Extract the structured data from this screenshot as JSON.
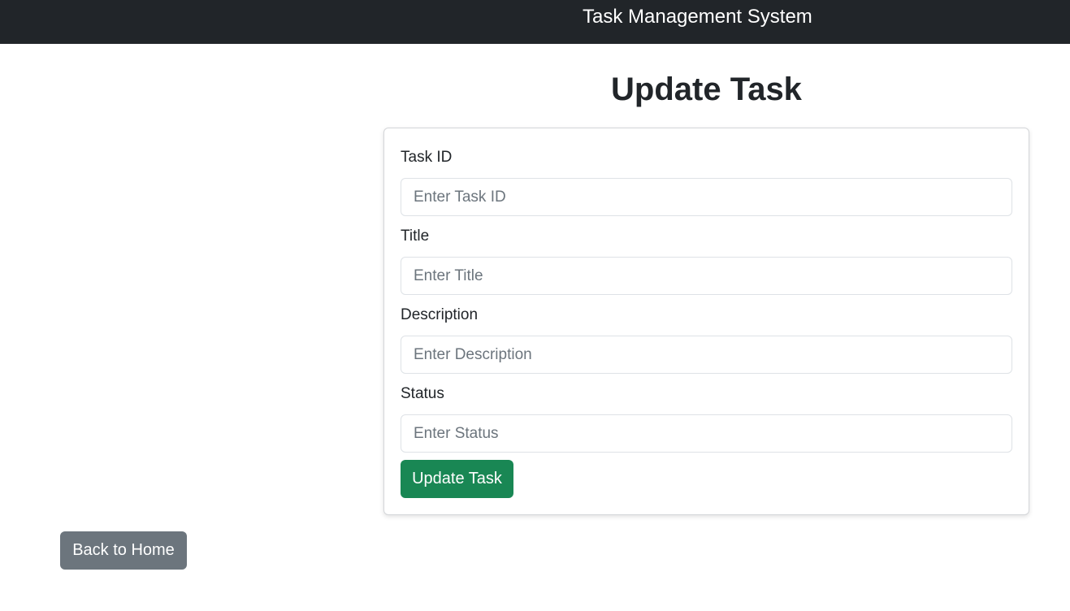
{
  "navbar": {
    "brand": "Task Management System"
  },
  "page": {
    "title": "Update Task"
  },
  "form": {
    "fields": [
      {
        "label": "Task ID",
        "placeholder": "Enter Task ID",
        "value": ""
      },
      {
        "label": "Title",
        "placeholder": "Enter Title",
        "value": ""
      },
      {
        "label": "Description",
        "placeholder": "Enter Description",
        "value": ""
      },
      {
        "label": "Status",
        "placeholder": "Enter Status",
        "value": ""
      }
    ],
    "submit_label": "Update Task"
  },
  "back_button": {
    "label": "Back to Home"
  },
  "colors": {
    "navbar": "#212529",
    "success": "#198754",
    "secondary": "#6c757d"
  }
}
